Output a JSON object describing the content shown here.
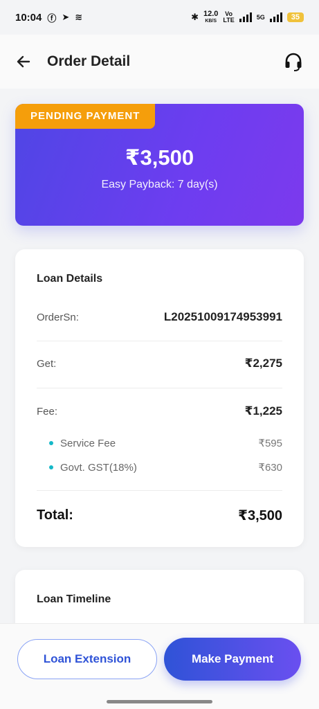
{
  "status_bar": {
    "time": "10:04",
    "speed_top": "12.0",
    "speed_unit": "KB/S",
    "volte_top": "Vo",
    "volte_bottom": "LTE",
    "network": "5G",
    "battery": "35"
  },
  "header": {
    "title": "Order Detail"
  },
  "hero": {
    "badge": "PENDING PAYMENT",
    "amount": "₹3,500",
    "subtitle": "Easy Payback: 7 day(s)",
    "colors": {
      "gradient_start": "#4f46e5",
      "gradient_end": "#7c3aed",
      "badge": "#f59e0b"
    }
  },
  "loan_details": {
    "title": "Loan Details",
    "order_label": "OrderSn:",
    "order_value": "L20251009174953991",
    "get_label": "Get:",
    "get_value": "₹2,275",
    "fee_label": "Fee:",
    "fee_value": "₹1,225",
    "fee_items": [
      {
        "label": "Service Fee",
        "value": "₹595"
      },
      {
        "label": "Govt. GST(18%)",
        "value": "₹630"
      }
    ],
    "total_label": "Total:",
    "total_value": "₹3,500"
  },
  "loan_timeline": {
    "title": "Loan Timeline"
  },
  "actions": {
    "extension_label": "Loan Extension",
    "payment_label": "Make Payment"
  }
}
